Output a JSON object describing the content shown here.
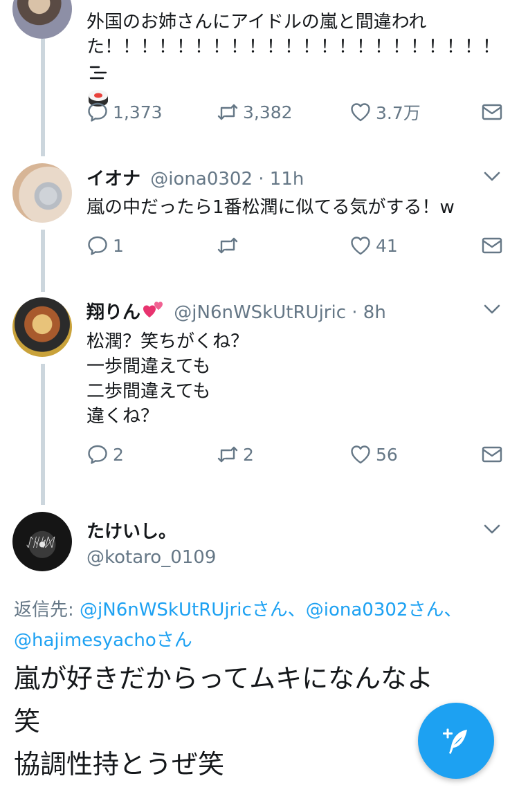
{
  "tweets": [
    {
      "text_line1": "外国のお姉さんにアイドルの嵐と間違われ",
      "text_line2": "た！！！！！！！！！！！！！！！！！！！！！！",
      "emoji": "sushi-icon",
      "replies": "1,373",
      "retweets": "3,382",
      "likes": "3.7万"
    },
    {
      "name": "イオナ",
      "handle": "@iona0302",
      "time": "11h",
      "text": "嵐の中だったら1番松潤に似てる気がする！w",
      "replies": "1",
      "retweets": "",
      "likes": "41"
    },
    {
      "name": "翔りん",
      "handle": "@jN6nWSkUtRUjric",
      "time": "8h",
      "lines": [
        "松潤？笑ちがくね？",
        "一歩間違えても",
        "二歩間違えても",
        "違くね？"
      ],
      "replies": "2",
      "retweets": "2",
      "likes": "56"
    },
    {
      "name": "たけいし。",
      "handle": "@kotaro_0109",
      "reply_to_label": "返信先: ",
      "mentions": [
        "@jN6nWSkUtRUjricさん、",
        "@iona0302さん、",
        "@hajimesyachoさん"
      ],
      "lines": [
        "嵐が好きだからってムキになんなよ",
        "笑",
        "協調性持とうぜ笑"
      ]
    }
  ],
  "separator": " · ",
  "colors": {
    "accent": "#1da1f2",
    "muted": "#657786",
    "line": "#ccd6dd"
  }
}
